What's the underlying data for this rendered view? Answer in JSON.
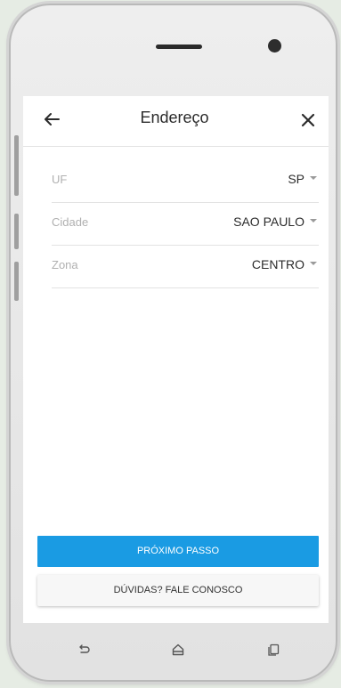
{
  "header": {
    "title": "Endereço"
  },
  "fields": [
    {
      "label": "UF",
      "value": "SP"
    },
    {
      "label": "Cidade",
      "value": "SAO PAULO"
    },
    {
      "label": "Zona",
      "value": "CENTRO"
    }
  ],
  "buttons": {
    "next_label": "PRÓXIMO PASSO",
    "help_label": "DÚVIDAS? FALE CONOSCO"
  },
  "colors": {
    "primary": "#1a9be3",
    "background": "#e6ece4"
  },
  "icons": {
    "back": "arrow-left-icon",
    "close": "close-icon",
    "nav_back": "nav-back-icon",
    "nav_home": "nav-home-icon",
    "nav_recents": "nav-recents-icon"
  }
}
